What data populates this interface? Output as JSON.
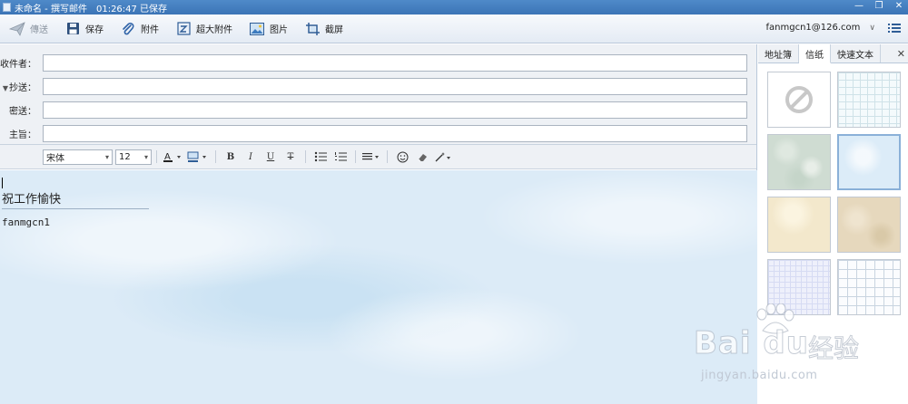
{
  "window": {
    "title": "未命名 - 撰写邮件",
    "status": "01:26:47 已保存",
    "minimize_glyph": "—",
    "restore_glyph": "❐",
    "close_glyph": "✕"
  },
  "toolbar": {
    "send_label": "傳送",
    "save_label": "保存",
    "attach_label": "附件",
    "big_attach_label": "超大附件",
    "image_label": "图片",
    "screenshot_label": "截屏",
    "account": "fanmgcn1@126.com",
    "account_arrow": "∨"
  },
  "fields": {
    "to_label": "收件者：",
    "cc_label": "抄送：",
    "cc_toggle": "▼",
    "bcc_label": "密送：",
    "subject_label": "主旨：",
    "to_value": "",
    "cc_value": "",
    "bcc_value": "",
    "subject_value": ""
  },
  "format": {
    "font_family": "宋体",
    "font_size": "12",
    "bold": "B",
    "italic": "I",
    "underline": "U",
    "strike": "T",
    "dropdown_glyph": "▾"
  },
  "editor": {
    "signature_title": "祝工作愉快",
    "signature_name": "fanmgcn1"
  },
  "side": {
    "tabs": [
      "地址簿",
      "信纸",
      "快速文本"
    ],
    "active_tab": "信纸",
    "close_glyph": "✕"
  },
  "watermark": {
    "logo": "Bai du",
    "cn": "经验",
    "url": "jingyan.baidu.com"
  },
  "colors": {
    "titlebar": "#3b74b6",
    "editor_bg": "#dcebf7",
    "panel_bg": "#eef1f5"
  }
}
